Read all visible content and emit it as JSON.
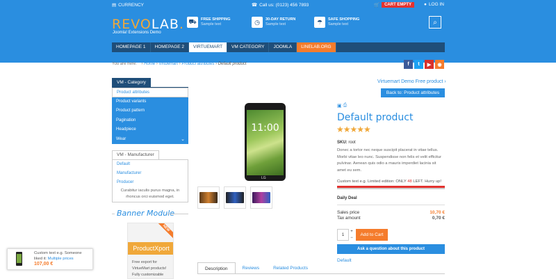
{
  "topbar": {
    "currency": "CURRENCY",
    "call": "Call us: (0123) 456 7893",
    "cart": "CART EMPTY",
    "login": "LOG IN"
  },
  "logo": {
    "part1": "REVO",
    "part2": "LAB",
    "dot": ".",
    "subtitle": "Joomla! Extensions Demo"
  },
  "features": [
    {
      "title": "FREE SHIPPING",
      "sub": "Sample text"
    },
    {
      "title": "30-DAY RETURN",
      "sub": "Sample text"
    },
    {
      "title": "SAFE SHOPPING",
      "sub": "Sample text"
    }
  ],
  "nav": [
    "HOMEPAGE 1",
    "HOMEPAGE 2",
    "VIRTUEMART",
    "VM CATEGORY",
    "JOOMLA",
    "LINELAB.ORG"
  ],
  "breadcrumb": {
    "prefix": "You are here:",
    "items": [
      "Home",
      "Virtuemart",
      "Product attributes"
    ],
    "current": "Default product"
  },
  "social": [
    "f",
    "t",
    "▶",
    "◉"
  ],
  "category": {
    "title": "VM - Category",
    "items": [
      "Product attributes",
      "Product variants",
      "Product pattern",
      "Pagination",
      "Headpiece",
      "Wear"
    ]
  },
  "manufacturer": {
    "title": "VM - Manufacturer",
    "items": [
      "Default",
      "Manufacturer",
      "Producer"
    ],
    "desc1": "Curabitur iaculis purus magna, in",
    "desc2": "rhoncus orci euismod eget."
  },
  "banner": {
    "title": "Banner Module",
    "ribbon": "NEW",
    "name": "ProductXport",
    "desc1": "Free export for",
    "desc2": "VirtueMart products!",
    "desc3": "Fully customizable"
  },
  "product": {
    "next_link": "Virtuemart Demo Free product",
    "back_button": "Back to: Product attributes",
    "title": "Default product",
    "stars": "★★★★★",
    "sku_label": "SKU:",
    "sku_value": "root",
    "description": "Donec a tortor nec neque suscipit placerat in vitae tellus. Morbi vitae leo nunc. Suspendisse non felis et velit efficitur pulvinar. Aenean quis odio a mauris imperdiet lacinia sit amet eu sem.",
    "custom_text_pre": "Custom text e.g. Limited edition: ONLY ",
    "custom_text_num": "48",
    "custom_text_post": " LEFT. Hurry up!",
    "daily_deal": "Daily Deal",
    "sales_price_label": "Sales price",
    "sales_price": "10,70 €",
    "tax_label": "Tax amount",
    "tax": "0,70 €",
    "qty": "1",
    "add_to_cart": "Add to Cart",
    "ask_button": "Ask a question about this product",
    "manufacturer_link": "Default",
    "phone_time": "11:00",
    "phone_brand": "LG"
  },
  "tabs": [
    "Description",
    "Reviews",
    "Related Products"
  ],
  "popup": {
    "line1": "Custom text e.g. Someone",
    "line2_pre": "liked it: ",
    "line2_link": "Multiple prices",
    "price": "107,00 €"
  },
  "colors": {
    "primary": "#2a8ee0",
    "dark_blue": "#1f4e79",
    "orange": "#f57c2c",
    "gold": "#f0a83a",
    "red": "#e3322f"
  }
}
